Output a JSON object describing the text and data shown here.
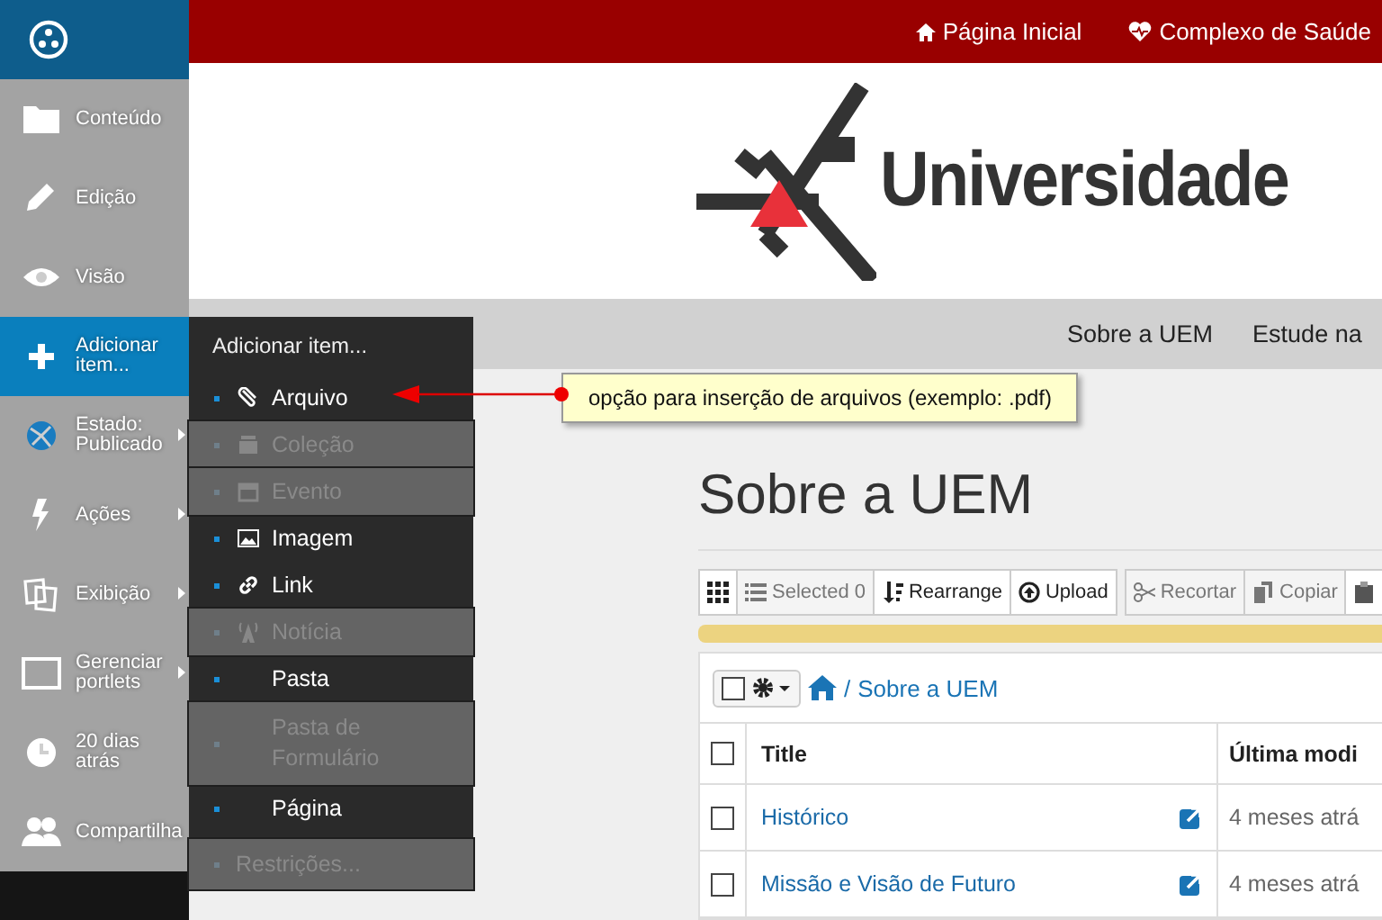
{
  "sidebar": {
    "items": [
      {
        "kind": "content",
        "label": "Conteúdo",
        "selected": false,
        "submenu": false
      },
      {
        "kind": "edit",
        "label": "Edição",
        "selected": false,
        "submenu": false
      },
      {
        "kind": "view",
        "label": "Visão",
        "selected": false,
        "submenu": false
      },
      {
        "kind": "add",
        "label": "Adicionar item...",
        "selected": true,
        "submenu": false
      },
      {
        "kind": "state",
        "label": "Estado: Publicado",
        "selected": false,
        "submenu": true
      },
      {
        "kind": "actions",
        "label": "Ações",
        "selected": false,
        "submenu": true
      },
      {
        "kind": "display",
        "label": "Exibição",
        "selected": false,
        "submenu": true
      },
      {
        "kind": "portlets",
        "label": "Gerenciar portlets",
        "selected": false,
        "submenu": true
      },
      {
        "kind": "history",
        "label": "20 dias atrás",
        "selected": false,
        "submenu": false
      },
      {
        "kind": "share",
        "label": "Compartilha",
        "selected": false,
        "submenu": false
      }
    ]
  },
  "add_menu": {
    "title": "Adicionar item...",
    "items": [
      {
        "kind": "file",
        "label": "Arquivo",
        "disabled": false
      },
      {
        "kind": "collection",
        "label": "Coleção",
        "disabled": true
      },
      {
        "kind": "event",
        "label": "Evento",
        "disabled": true
      },
      {
        "kind": "image",
        "label": "Imagem",
        "disabled": false
      },
      {
        "kind": "link",
        "label": "Link",
        "disabled": false
      },
      {
        "kind": "news",
        "label": "Notícia",
        "disabled": true
      },
      {
        "kind": "folder",
        "label": "Pasta",
        "disabled": false
      },
      {
        "kind": "form-folder",
        "label": "Pasta de Formulário",
        "disabled": true
      },
      {
        "kind": "page",
        "label": "Página",
        "disabled": false
      }
    ],
    "footer": {
      "label": "Restrições...",
      "disabled": true
    }
  },
  "annotation": {
    "text": "opção para inserção de arquivos (exemplo: .pdf)"
  },
  "top_bar": {
    "links": [
      {
        "kind": "home",
        "label": "Página Inicial"
      },
      {
        "kind": "health",
        "label": "Complexo de Saúde"
      }
    ]
  },
  "header": {
    "logo_text": "Universidade"
  },
  "nav": {
    "items": [
      "Sobre a UEM",
      "Estude na"
    ]
  },
  "page_title": "Sobre a UEM",
  "toolbar": {
    "buttons": [
      {
        "kind": "grid",
        "disabled": false
      },
      {
        "kind": "list",
        "label": "Selected 0",
        "disabled": true
      },
      {
        "kind": "rearrange",
        "label": "Rearrange",
        "disabled": false
      },
      {
        "kind": "upload",
        "label": "Upload",
        "disabled": false
      },
      {
        "kind": "cut",
        "label": "Recortar",
        "disabled": true
      },
      {
        "kind": "copy",
        "label": "Copiar",
        "disabled": true
      },
      {
        "kind": "paste"
      }
    ]
  },
  "breadcrumb": {
    "checked": false,
    "separator": "/",
    "crumb": "Sobre a UEM"
  },
  "table": {
    "header_checked": false,
    "columns": [
      "Title",
      "Última modi"
    ],
    "rows": [
      {
        "checked": false,
        "title": "Histórico",
        "column_2": "4 meses atrá"
      },
      {
        "checked": false,
        "title": "Missão e Visão de Futuro",
        "column_2": "4 meses atrá"
      }
    ]
  }
}
